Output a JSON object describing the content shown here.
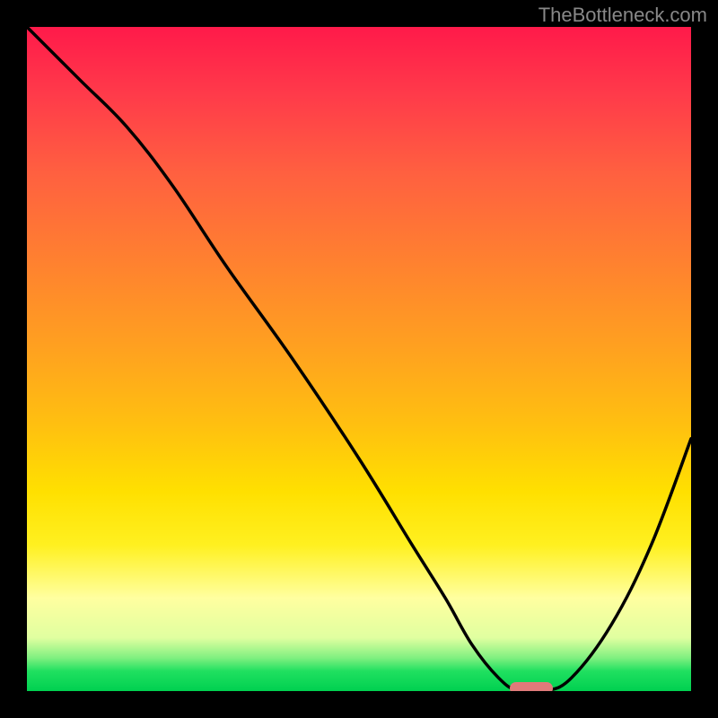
{
  "watermark": "TheBottleneck.com",
  "chart_data": {
    "type": "line",
    "title": "",
    "xlabel": "",
    "ylabel": "",
    "xlim": [
      0,
      100
    ],
    "ylim": [
      0,
      100
    ],
    "x": [
      0,
      8,
      15,
      22,
      30,
      40,
      50,
      58,
      63,
      67,
      71,
      74,
      78,
      82,
      88,
      94,
      100
    ],
    "values": [
      100,
      92,
      85,
      76,
      64,
      50,
      35,
      22,
      14,
      7,
      2,
      0,
      0,
      2,
      10,
      22,
      38
    ],
    "annotations": [
      {
        "type": "marker",
        "x": 76,
        "y": 0,
        "color": "#e07a7a"
      }
    ],
    "background": "red-yellow-green vertical gradient",
    "grid": false,
    "legend": false
  }
}
